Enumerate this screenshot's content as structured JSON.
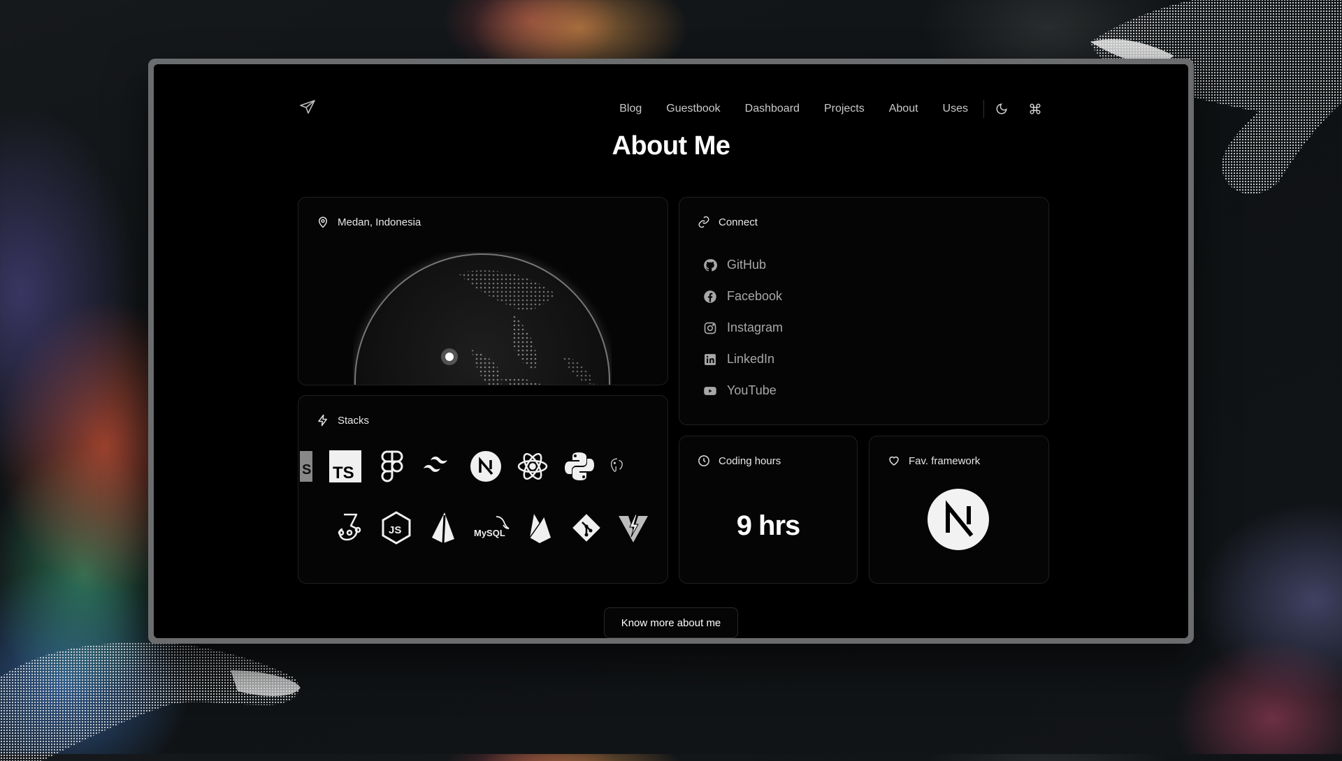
{
  "nav": {
    "logo_icon": "paper-plane-icon",
    "links": [
      "Blog",
      "Guestbook",
      "Dashboard",
      "Projects",
      "About",
      "Uses"
    ],
    "theme_icon": "moon-icon",
    "command_icon": "command-icon"
  },
  "page": {
    "title": "About Me"
  },
  "location": {
    "label": "Medan, Indonesia",
    "icon": "map-pin-icon"
  },
  "connect": {
    "label": "Connect",
    "icon": "link-icon",
    "items": [
      {
        "label": "GitHub",
        "icon": "github-icon"
      },
      {
        "label": "Facebook",
        "icon": "facebook-icon"
      },
      {
        "label": "Instagram",
        "icon": "instagram-icon"
      },
      {
        "label": "LinkedIn",
        "icon": "linkedin-icon"
      },
      {
        "label": "YouTube",
        "icon": "youtube-icon"
      }
    ]
  },
  "stacks": {
    "label": "Stacks",
    "icon": "lightning-icon",
    "row1": [
      "sass-icon",
      "typescript-icon",
      "figma-icon",
      "tailwind-icon",
      "nextjs-icon",
      "react-icon",
      "python-icon",
      "postgresql-icon"
    ],
    "row2": [
      "jest-icon",
      "nodejs-icon",
      "prisma-icon",
      "mysql-icon",
      "firebase-icon",
      "git-icon",
      "vitest-icon"
    ],
    "ts_text": "TS",
    "js_text": "JS",
    "mysql_text": "MySQL"
  },
  "coding_hours": {
    "label": "Coding hours",
    "value": "9 hrs",
    "icon": "clock-icon"
  },
  "fav_framework": {
    "label": "Fav. framework",
    "icon": "heart-icon",
    "logo": "nextjs-logo"
  },
  "cta": {
    "label": "Know more about me"
  }
}
